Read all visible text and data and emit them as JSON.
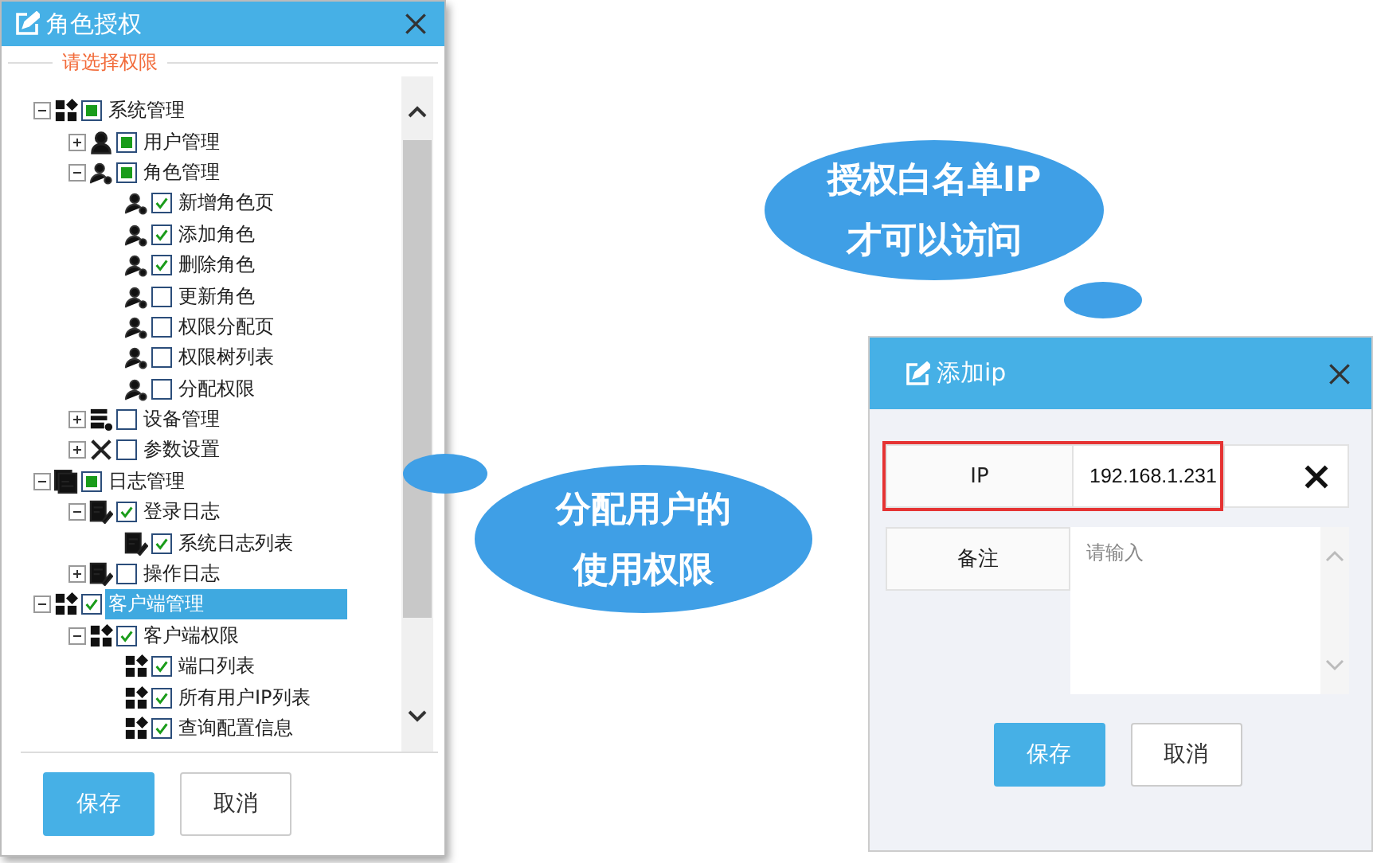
{
  "role_dialog": {
    "title": "角色授权",
    "legend": "请选择权限",
    "tree": [
      {
        "label": "系统管理",
        "kind": "grid",
        "checked": false,
        "partial": true,
        "expanded": true,
        "selected": false,
        "children": [
          {
            "label": "用户管理",
            "kind": "user",
            "checked": false,
            "partial": true,
            "expanded": false,
            "selected": false
          },
          {
            "label": "角色管理",
            "kind": "role",
            "checked": false,
            "partial": true,
            "expanded": true,
            "selected": false,
            "children": [
              {
                "label": "新增角色页",
                "kind": "role",
                "checked": true,
                "selected": false
              },
              {
                "label": "添加角色",
                "kind": "role",
                "checked": true,
                "selected": false
              },
              {
                "label": "删除角色",
                "kind": "role",
                "checked": true,
                "selected": false
              },
              {
                "label": "更新角色",
                "kind": "role",
                "checked": false,
                "partial": false,
                "selected": false
              },
              {
                "label": "权限分配页",
                "kind": "role",
                "checked": false,
                "partial": false,
                "selected": false
              },
              {
                "label": "权限树列表",
                "kind": "role",
                "checked": false,
                "partial": false,
                "selected": false
              },
              {
                "label": "分配权限",
                "kind": "role",
                "checked": false,
                "partial": false,
                "selected": false
              }
            ]
          },
          {
            "label": "设备管理",
            "kind": "server",
            "checked": false,
            "partial": false,
            "expanded": false,
            "selected": false
          },
          {
            "label": "参数设置",
            "kind": "tools",
            "checked": false,
            "partial": false,
            "expanded": false,
            "selected": false
          }
        ]
      },
      {
        "label": "日志管理",
        "kind": "log",
        "checked": false,
        "partial": true,
        "expanded": true,
        "selected": false,
        "children": [
          {
            "label": "登录日志",
            "kind": "doc",
            "checked": true,
            "expanded": true,
            "selected": false,
            "children": [
              {
                "label": "系统日志列表",
                "kind": "doc",
                "checked": true,
                "selected": false
              }
            ]
          },
          {
            "label": "操作日志",
            "kind": "doc",
            "checked": false,
            "partial": false,
            "expanded": false,
            "selected": false
          }
        ]
      },
      {
        "label": "客户端管理",
        "kind": "grid",
        "checked": true,
        "expanded": true,
        "selected": true,
        "children": [
          {
            "label": "客户端权限",
            "kind": "grid",
            "checked": true,
            "expanded": true,
            "selected": false,
            "children": [
              {
                "label": "端口列表",
                "kind": "grid",
                "checked": true,
                "selected": false
              },
              {
                "label": "所有用户IP列表",
                "kind": "grid",
                "checked": true,
                "selected": false
              },
              {
                "label": "查询配置信息",
                "kind": "grid",
                "checked": true,
                "selected": false
              }
            ]
          }
        ]
      }
    ],
    "buttons": [
      {
        "label": "保存",
        "kind": "primary"
      },
      {
        "label": "取消",
        "kind": "secondary"
      }
    ]
  },
  "ip_dialog": {
    "title": "添加ip",
    "fields": [
      {
        "label": "IP",
        "value": "192.168.1.231",
        "kind": "input",
        "highlighted": true
      },
      {
        "label": "备注",
        "placeholder": "请输入",
        "kind": "textarea",
        "highlighted": false
      }
    ],
    "buttons": [
      {
        "label": "保存",
        "kind": "primary"
      },
      {
        "label": "取消",
        "kind": "secondary"
      }
    ]
  },
  "callouts": [
    {
      "lines": [
        "授权白名单IP",
        "才可以访问"
      ],
      "kind": "top"
    },
    {
      "lines": [
        "分配用户的",
        "使用权限"
      ],
      "kind": "left"
    }
  ]
}
